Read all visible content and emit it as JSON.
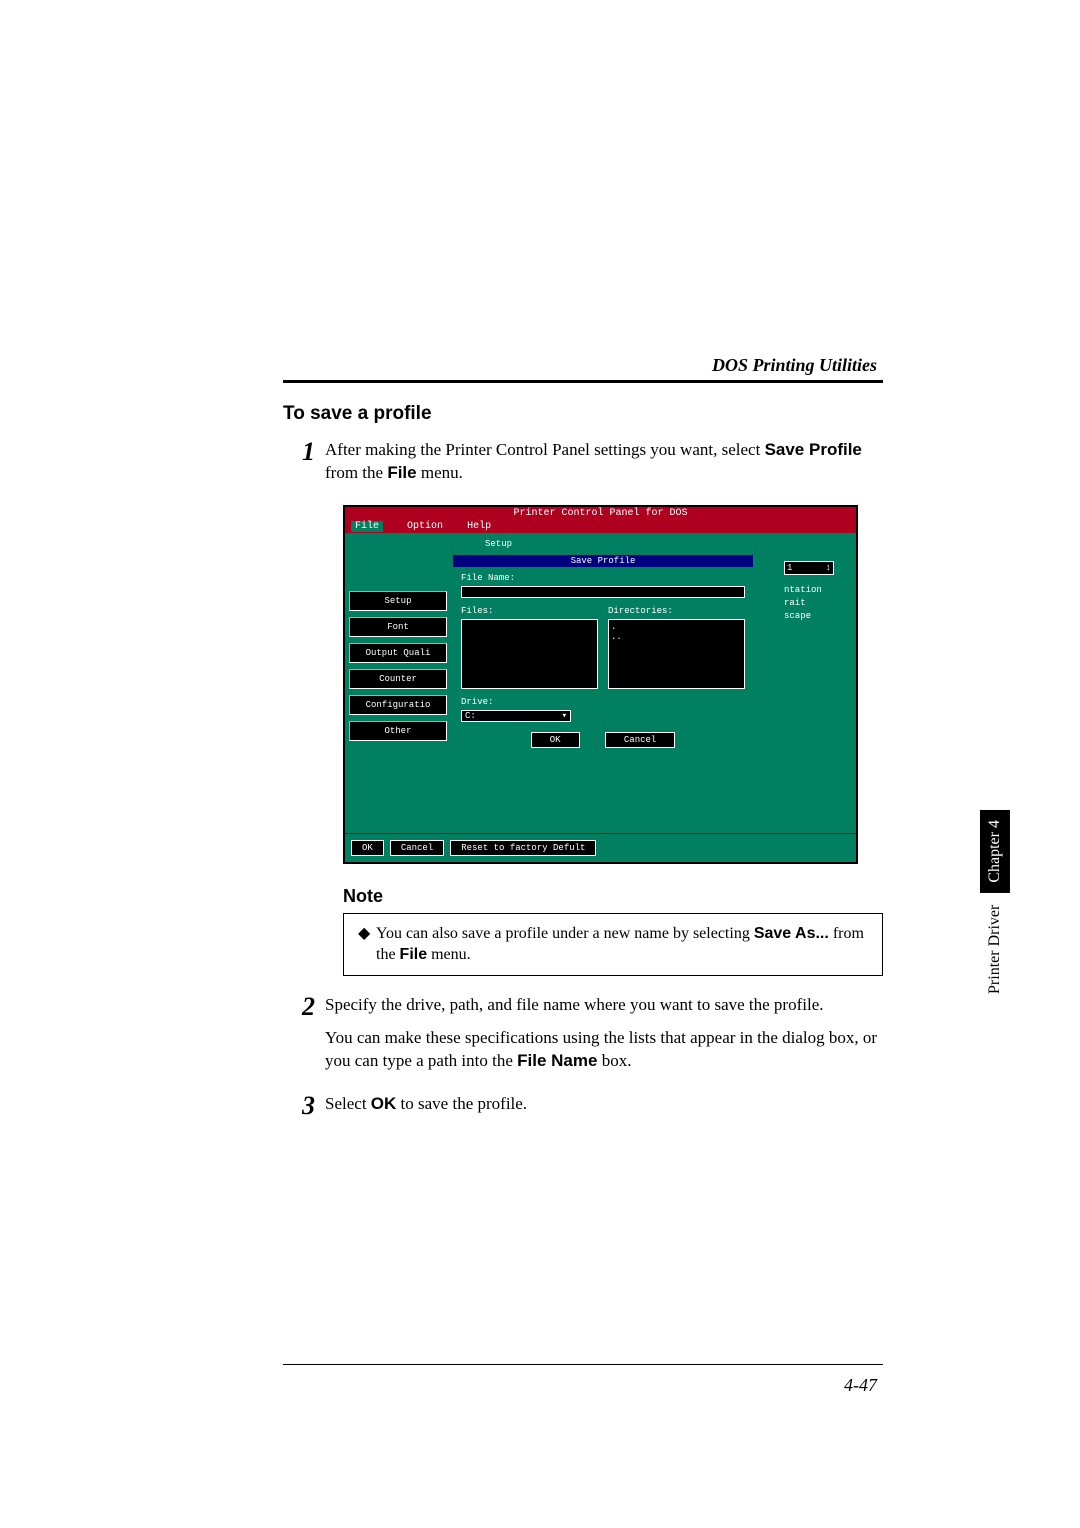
{
  "header": {
    "section_title": "DOS Printing Utilities"
  },
  "subsection": {
    "title": "To save a profile"
  },
  "steps": {
    "s1": {
      "num": "1",
      "text_a": "After making the Printer Control Panel settings you want, select ",
      "bold_save_profile": "Save Profile",
      "text_b": " from the ",
      "bold_file": "File",
      "text_c": " menu."
    },
    "s2": {
      "num": "2",
      "p1": "Specify the drive, path, and file name where you want to save the profile.",
      "p2_a": "You can make these specifications using the lists that appear in the dialog box, or you can type a path into the ",
      "p2_bold": "File Name",
      "p2_b": " box."
    },
    "s3": {
      "num": "3",
      "text_a": "Select ",
      "bold_ok": "OK",
      "text_b": " to save the profile."
    }
  },
  "dos": {
    "title": "Printer Control Panel for DOS",
    "menu": {
      "file": "File",
      "option": "Option",
      "help": "Help"
    },
    "sidebar": [
      "Setup",
      "Font",
      "Output Quali",
      "Counter",
      "Configuratio",
      "Other"
    ],
    "setup_label": "Setup",
    "save_profile_title": "Save Profile",
    "labels": {
      "file_name": "File Name:",
      "files": "Files:",
      "directories": "Directories:",
      "drive": "Drive:",
      "drive_value": "C:"
    },
    "dir_items": [
      ".",
      ".."
    ],
    "right": {
      "spinner_value": "1",
      "ntation": "ntation",
      "rait": "rait",
      "scape": "scape"
    },
    "btns": {
      "ok": "OK",
      "cancel": "Cancel",
      "reset": "Reset to factory Defult"
    }
  },
  "note": {
    "title": "Note",
    "bullet_a": "You can also save a profile under a new name by selecting ",
    "bullet_bold1": "Save As...",
    "bullet_b": " from the ",
    "bullet_bold2": "File",
    "bullet_c": " menu."
  },
  "footer": {
    "page_number": "4-47"
  },
  "sidetab": {
    "plain": "Printer Driver",
    "chapter": "Chapter 4"
  }
}
